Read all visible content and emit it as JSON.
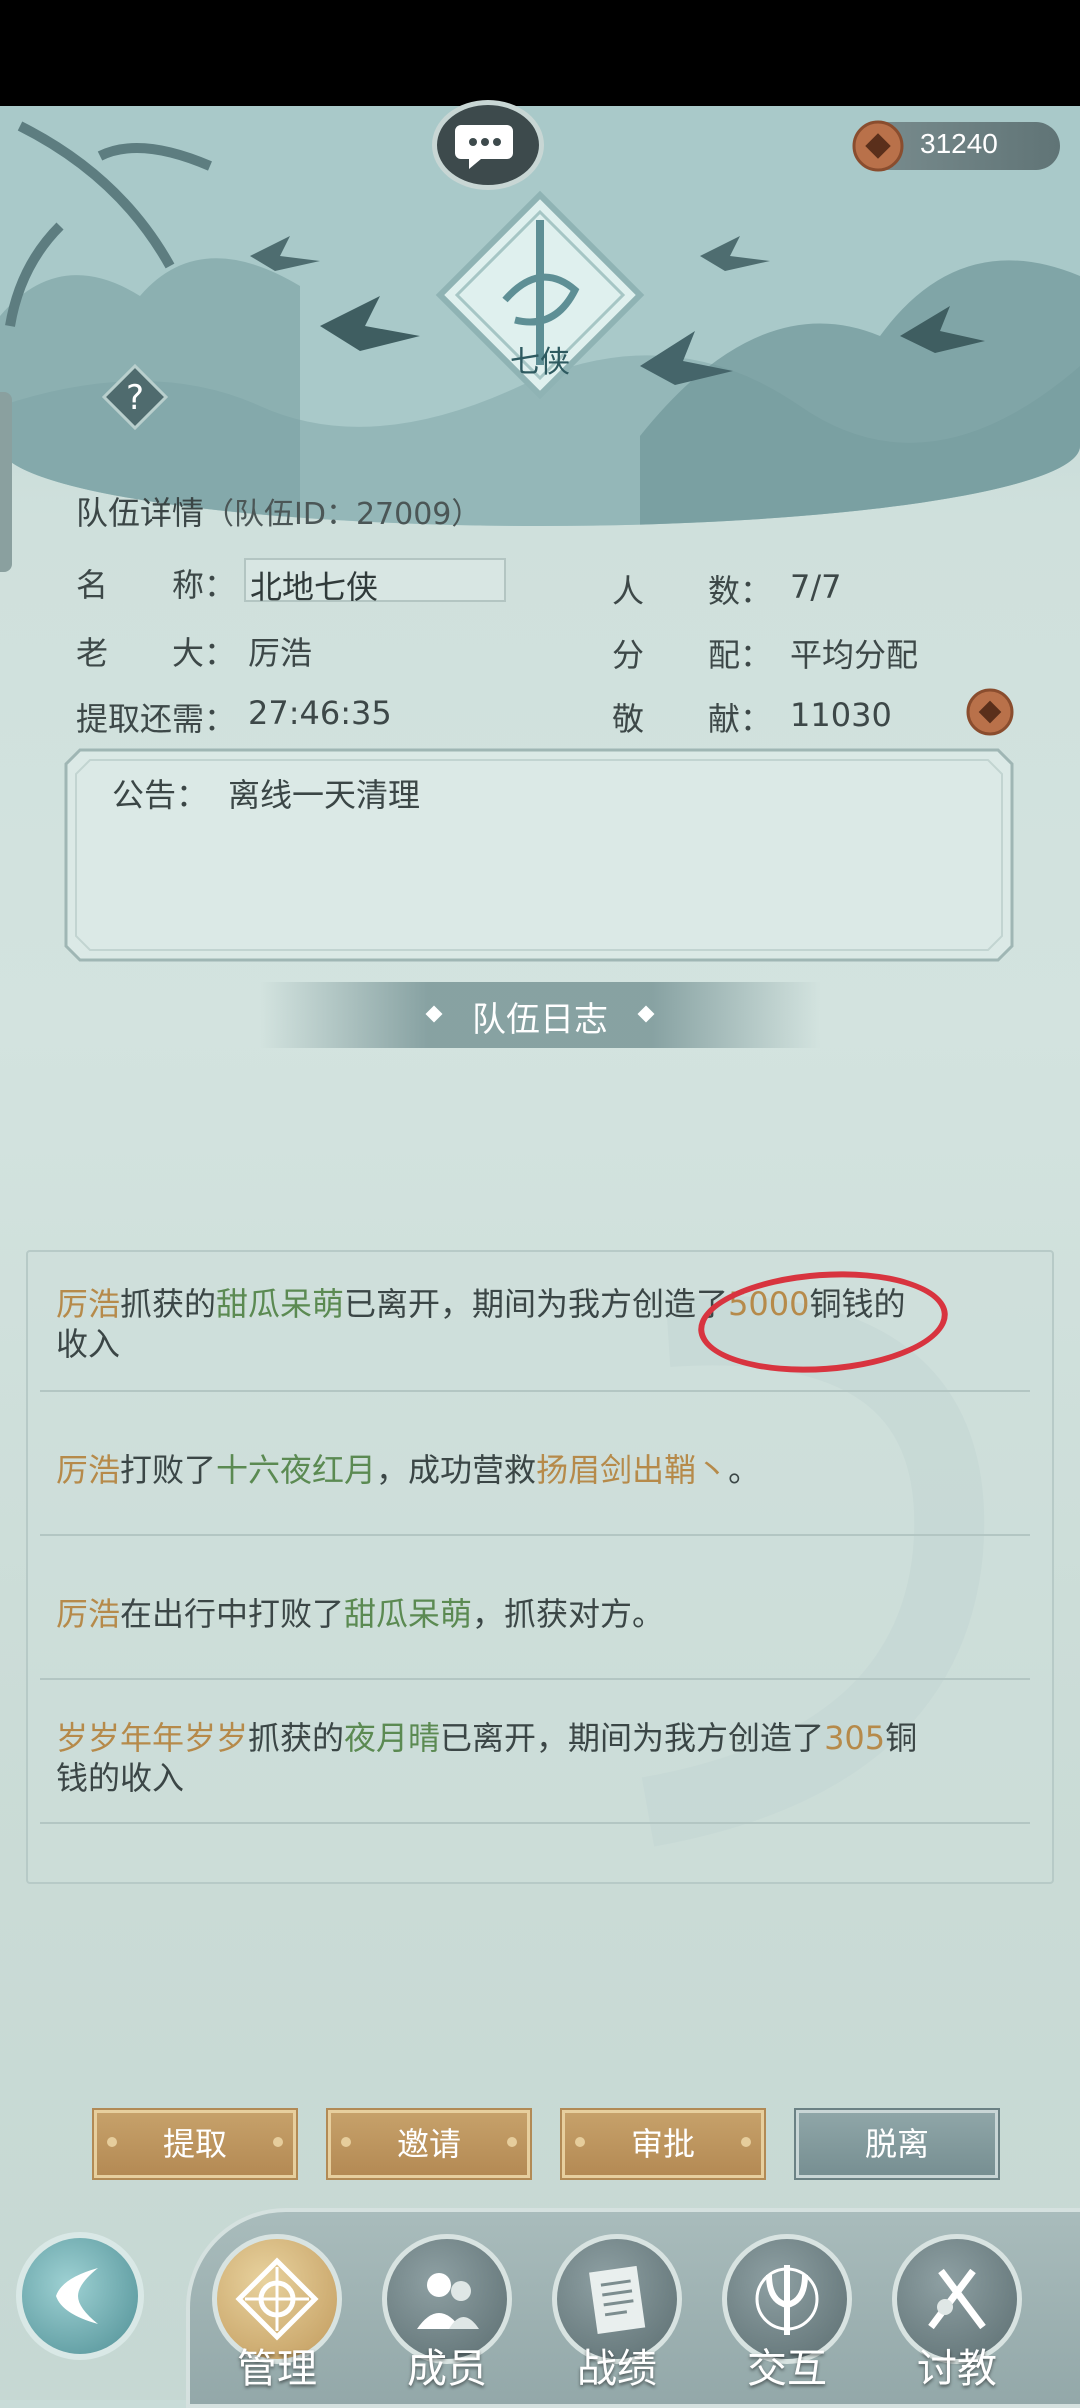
{
  "header": {
    "coins": "31240",
    "emblem_text": "七侠"
  },
  "team": {
    "title": "队伍详情",
    "id_text": "（队伍ID：27009）",
    "name_label": "名　　称：",
    "name_value": "北地七侠",
    "members_label": "人　　数：",
    "members_value": "7/7",
    "leader_label": "老　　大：",
    "leader_value": "厉浩",
    "distribution_label": "分　　配：",
    "distribution_value": "平均分配",
    "withdraw_label": "提取还需：",
    "withdraw_value": "27:46:35",
    "contribution_label": "敬　　献：",
    "contribution_value": "11030"
  },
  "notice": {
    "label": "公告：",
    "text": "离线一天清理"
  },
  "log": {
    "title": "队伍日志",
    "entries": [
      {
        "p1": "厉浩",
        "p2": "抓获的",
        "p3": "甜瓜呆萌",
        "p4": "已离开，期间为我方创造了",
        "p5": "5000",
        "p6": "铜钱的",
        "p7": "收入"
      },
      {
        "p1": "厉浩",
        "p2": "打败了",
        "p3": "十六夜红月",
        "p4": "，成功营救",
        "p5": "扬眉剑出鞘丶",
        "p6": "。"
      },
      {
        "p1": "厉浩",
        "p2": "在出行中打败了",
        "p3": "甜瓜呆萌",
        "p4": "，抓获对方。"
      },
      {
        "p1": "岁岁年年岁岁",
        "p2": "抓获的",
        "p3": "夜月晴",
        "p4": "已离开，期间为我方创造了",
        "p5": "305",
        "p6": "铜",
        "p7": "钱的收入"
      }
    ]
  },
  "actions": {
    "withdraw": "提取",
    "invite": "邀请",
    "approve": "审批",
    "leave": "脱离"
  },
  "nav": {
    "manage": "管理",
    "members": "成员",
    "records": "战绩",
    "interact": "交互",
    "teach": "讨教"
  },
  "colors": {
    "accent_gold": "#b68a4a",
    "accent_green": "#5b8a52",
    "highlight_red": "#d8343f"
  }
}
